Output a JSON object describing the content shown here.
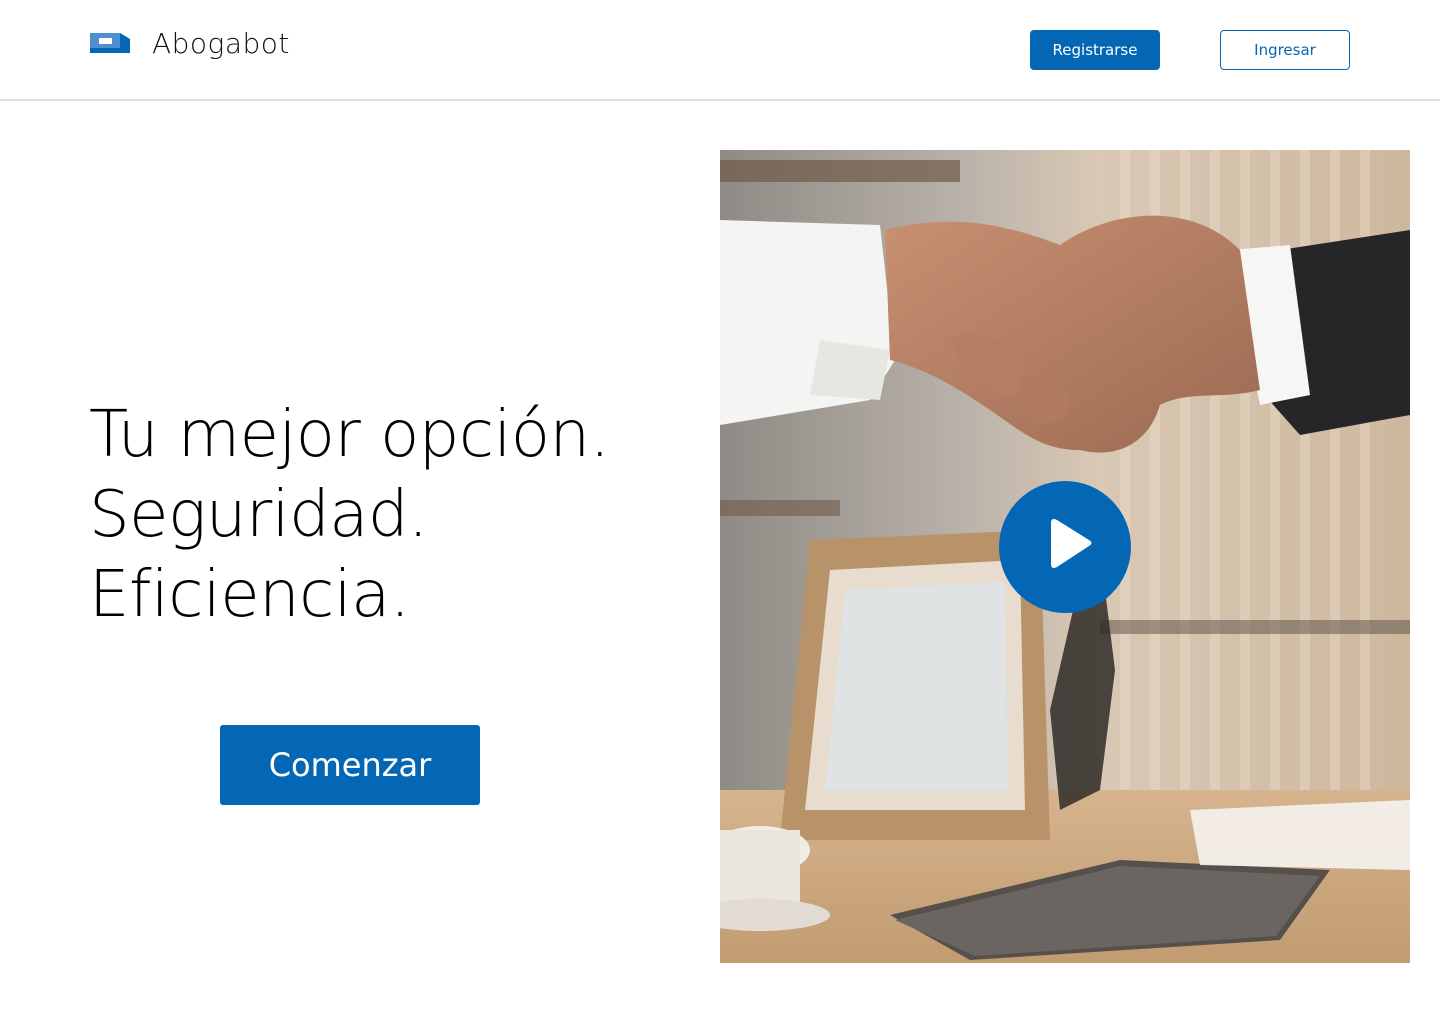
{
  "header": {
    "brand": "Abogabot",
    "register_label": "Registrarse",
    "login_label": "Ingresar"
  },
  "hero": {
    "lines": [
      "Tu mejor opción.",
      "Seguridad.",
      "Eficiencia."
    ],
    "cta_label": "Comenzar"
  },
  "media": {
    "image_subject": "handshake-photo",
    "play_icon": "play-icon"
  },
  "colors": {
    "accent": "#0467b5",
    "background": "#ffffff",
    "divider": "#dedede"
  }
}
